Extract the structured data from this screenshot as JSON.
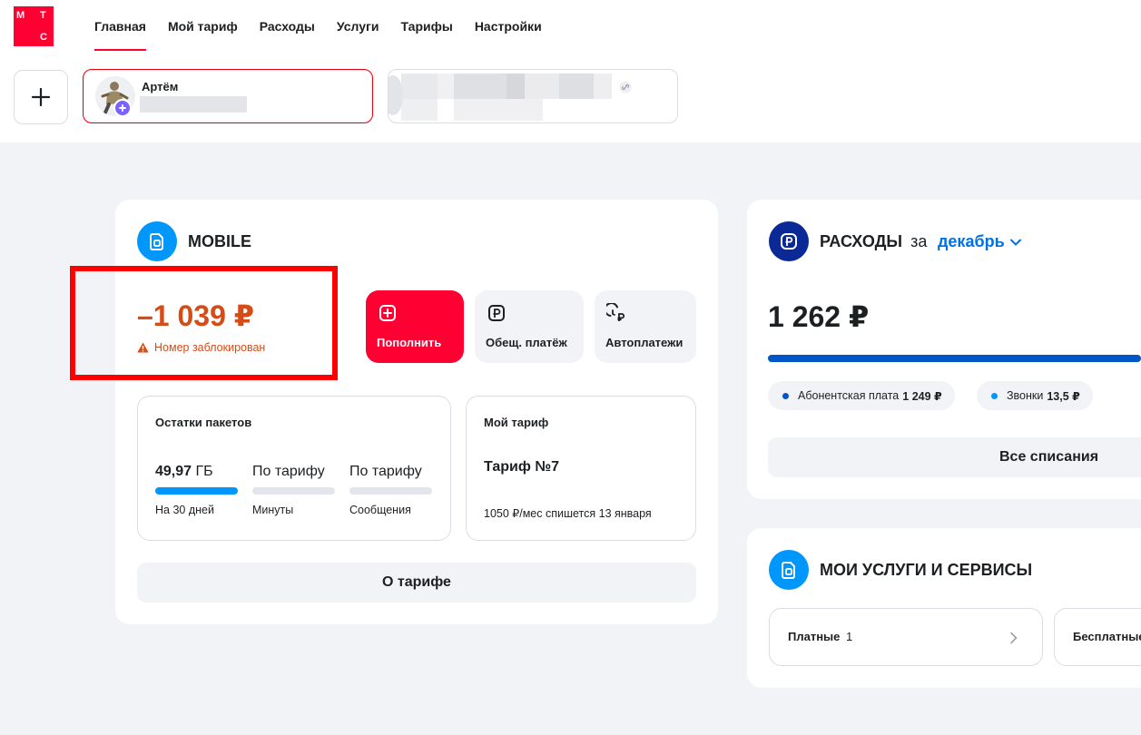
{
  "brand": {
    "logo_letters": [
      "М",
      "Т",
      "С"
    ],
    "accent": "#ff0032"
  },
  "nav": {
    "items": [
      {
        "label": "Главная",
        "active": true
      },
      {
        "label": "Мой тариф",
        "active": false
      },
      {
        "label": "Расходы",
        "active": false
      },
      {
        "label": "Услуги",
        "active": false
      },
      {
        "label": "Тарифы",
        "active": false
      },
      {
        "label": "Настройки",
        "active": false
      }
    ]
  },
  "accounts": {
    "add_icon": "plus-icon",
    "primary": {
      "name": "Артём"
    }
  },
  "mobile": {
    "title": "MOBILE",
    "balance": "–1 039 ₽",
    "status": "Номер заблокирован",
    "status_color": "#d64c16",
    "actions": {
      "topup": "Пополнить",
      "common": "Обещ. платёж",
      "auto": "Автоплатежи"
    },
    "packages": {
      "title": "Остатки пакетов",
      "items": [
        {
          "value": "49,97",
          "unit": "ГБ",
          "label": "На 30 дней",
          "fill": 1.0
        },
        {
          "value": "По тарифу",
          "unit": "",
          "label": "Минуты",
          "fill": 0
        },
        {
          "value": "По тарифу",
          "unit": "",
          "label": "Сообщения",
          "fill": 0
        }
      ]
    },
    "tariff": {
      "title": "Мой тариф",
      "name": "Тариф №7",
      "note": "1050 ₽/мес спишется 13 января"
    },
    "about_button": "О тарифе"
  },
  "expenses": {
    "title": "РАСХОДЫ",
    "for_word": "за",
    "month": "декабрь",
    "total": "1 262 ₽",
    "chips": [
      {
        "label": "Абонентская плата",
        "value": "1 249 ₽",
        "color": "#0055c8"
      },
      {
        "label": "Звонки",
        "value": "13,5 ₽",
        "color": "#0097fd"
      }
    ],
    "all_button": "Все списания"
  },
  "services": {
    "title": "МОИ УСЛУГИ И СЕРВИСЫ",
    "paid_label": "Платные",
    "paid_count": "1",
    "free_label": "Бесплатные"
  }
}
